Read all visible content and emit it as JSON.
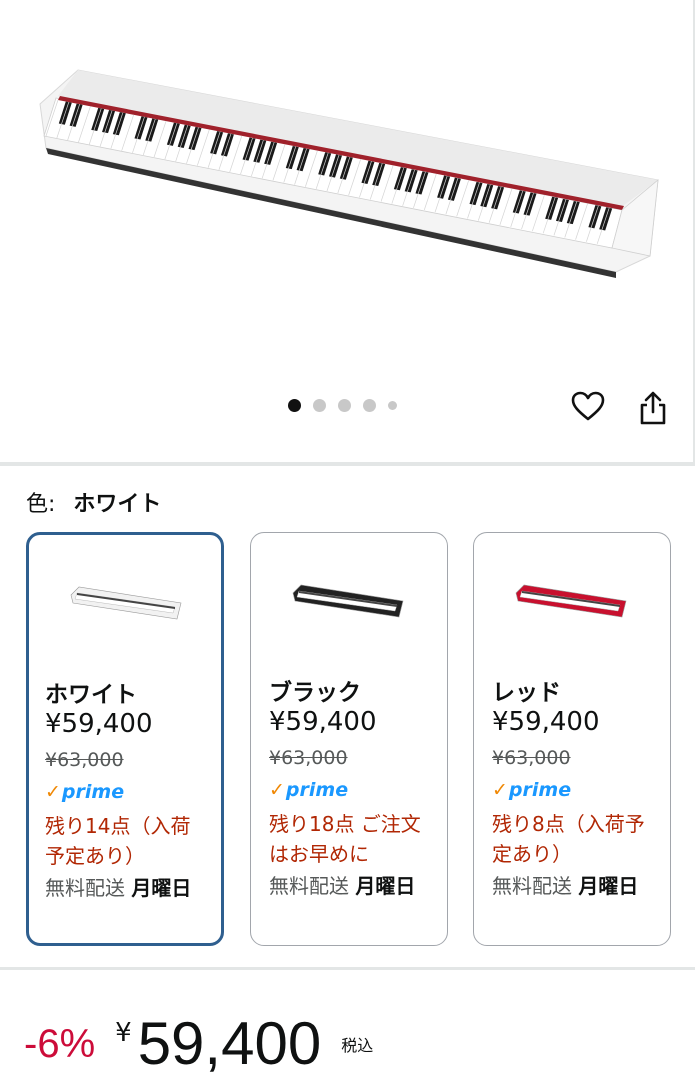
{
  "gallery": {
    "image_alt": "piano-product-image",
    "dots": [
      true,
      false,
      false,
      false,
      false
    ]
  },
  "actions": {
    "wishlist_icon": "heart-icon",
    "share_icon": "share-icon"
  },
  "color_selector": {
    "label": "色:",
    "selected_value": "ホワイト"
  },
  "variants": [
    {
      "name": "ホワイト",
      "price": "¥59,400",
      "list_price": "¥63,000",
      "prime": "prime",
      "stock": "残り14点（入荷予定あり）",
      "shipping": "無料配送",
      "delivery_day": "月曜日",
      "color": "#f2f2f2",
      "selected": true
    },
    {
      "name": "ブラック",
      "price": "¥59,400",
      "list_price": "¥63,000",
      "prime": "prime",
      "stock": "残り18点 ご注文はお早めに",
      "shipping": "無料配送",
      "delivery_day": "月曜日",
      "color": "#222222",
      "selected": false
    },
    {
      "name": "レッド",
      "price": "¥59,400",
      "list_price": "¥63,000",
      "prime": "prime",
      "stock": "残り8点（入荷予定あり）",
      "shipping": "無料配送",
      "delivery_day": "月曜日",
      "color": "#c8102e",
      "selected": false
    }
  ],
  "price": {
    "discount": "-6%",
    "currency": "¥",
    "amount": "59,400",
    "tax": "税込"
  },
  "colors": {
    "discount_red": "#cc0c39",
    "stock_red": "#b12704",
    "prime_blue": "#1a98ff",
    "selected_border": "#2f5f8f"
  }
}
